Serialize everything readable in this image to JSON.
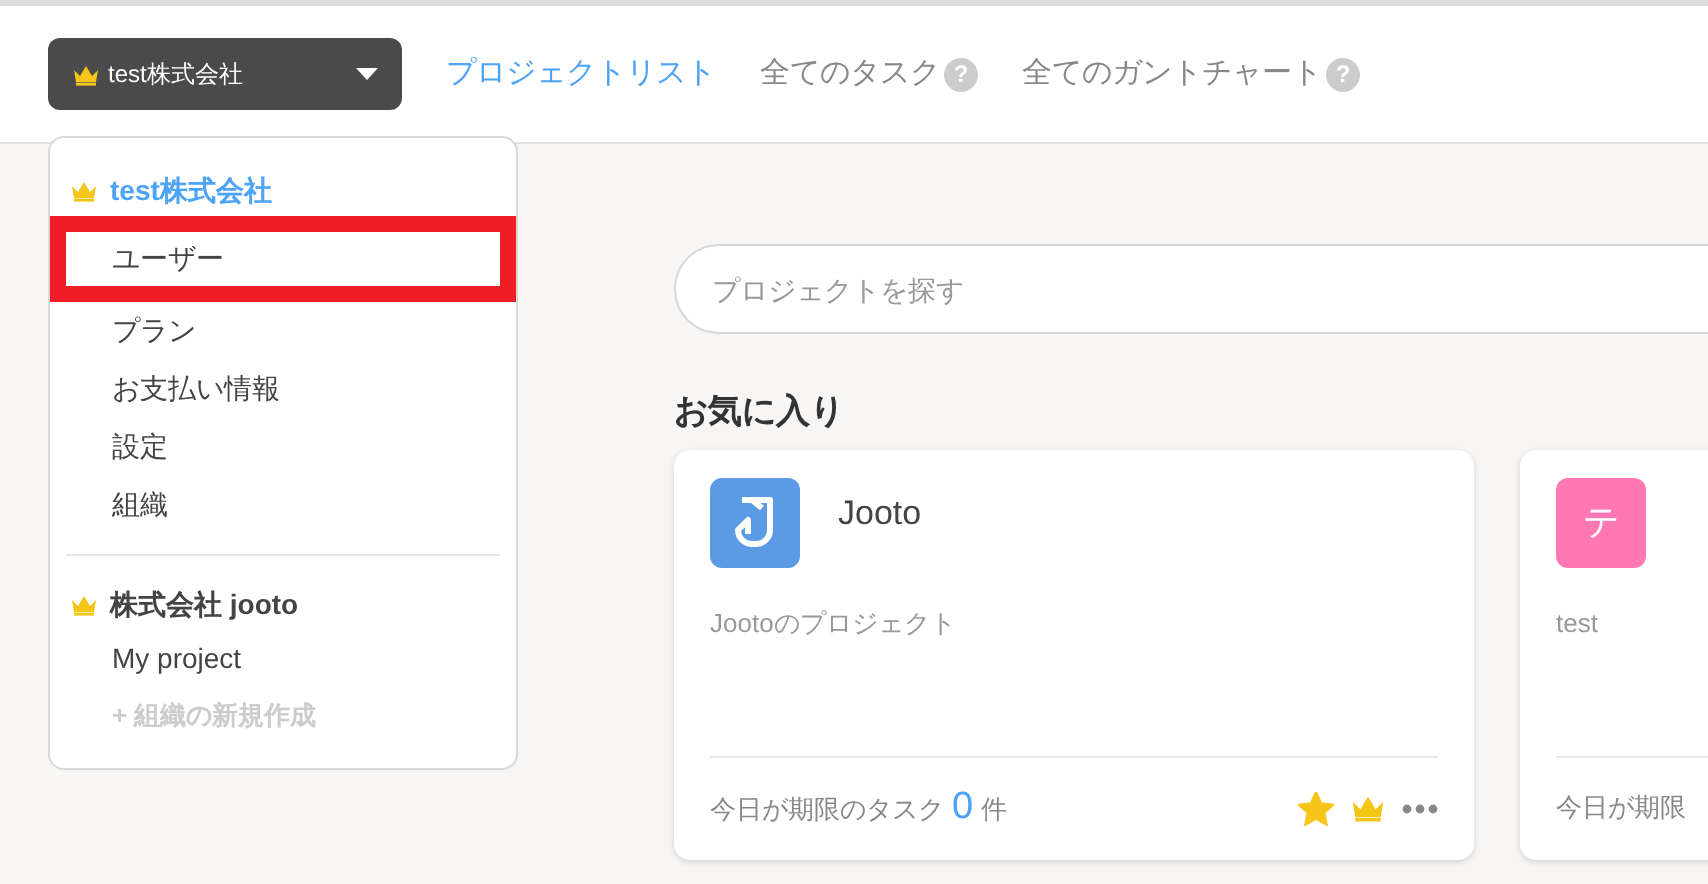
{
  "org_button": {
    "label": "test株式会社"
  },
  "nav": [
    {
      "label": "プロジェクトリスト",
      "selected": true
    },
    {
      "label": "全てのタスク",
      "selected": false,
      "help_mark": "?"
    },
    {
      "label": "全てのガントチャート",
      "selected": false,
      "help_mark": "?"
    }
  ],
  "menu": {
    "groups": [
      {
        "name": "test株式会社",
        "current": true,
        "items": [
          {
            "label": "ユーザー",
            "highlighted": true
          },
          {
            "label": "プラン",
            "highlighted": false
          },
          {
            "label": "お支払い情報",
            "highlighted": false
          },
          {
            "label": "設定",
            "highlighted": false
          },
          {
            "label": "組織",
            "highlighted": false
          }
        ]
      },
      {
        "name": "株式会社 jooto",
        "current": false,
        "items": [
          {
            "label": "My project",
            "highlighted": false
          }
        ]
      }
    ],
    "create_label": "+ 組織の新規作成"
  },
  "search": {
    "placeholder": "プロジェクトを探す"
  },
  "favorites": {
    "title": "お気に入り",
    "cards": [
      {
        "kind": "logo",
        "color": "#5b9be6",
        "title": "Jooto",
        "description": "Jootoのプロジェクト",
        "due_prefix": "今日が期限のタスク",
        "due_count": "0",
        "due_suffix": "件",
        "favorite": true,
        "owner": true
      },
      {
        "kind": "letter",
        "icon_text": "テ",
        "color": "#ff78b4",
        "description": "test",
        "due_prefix": "今日が期限"
      }
    ]
  }
}
